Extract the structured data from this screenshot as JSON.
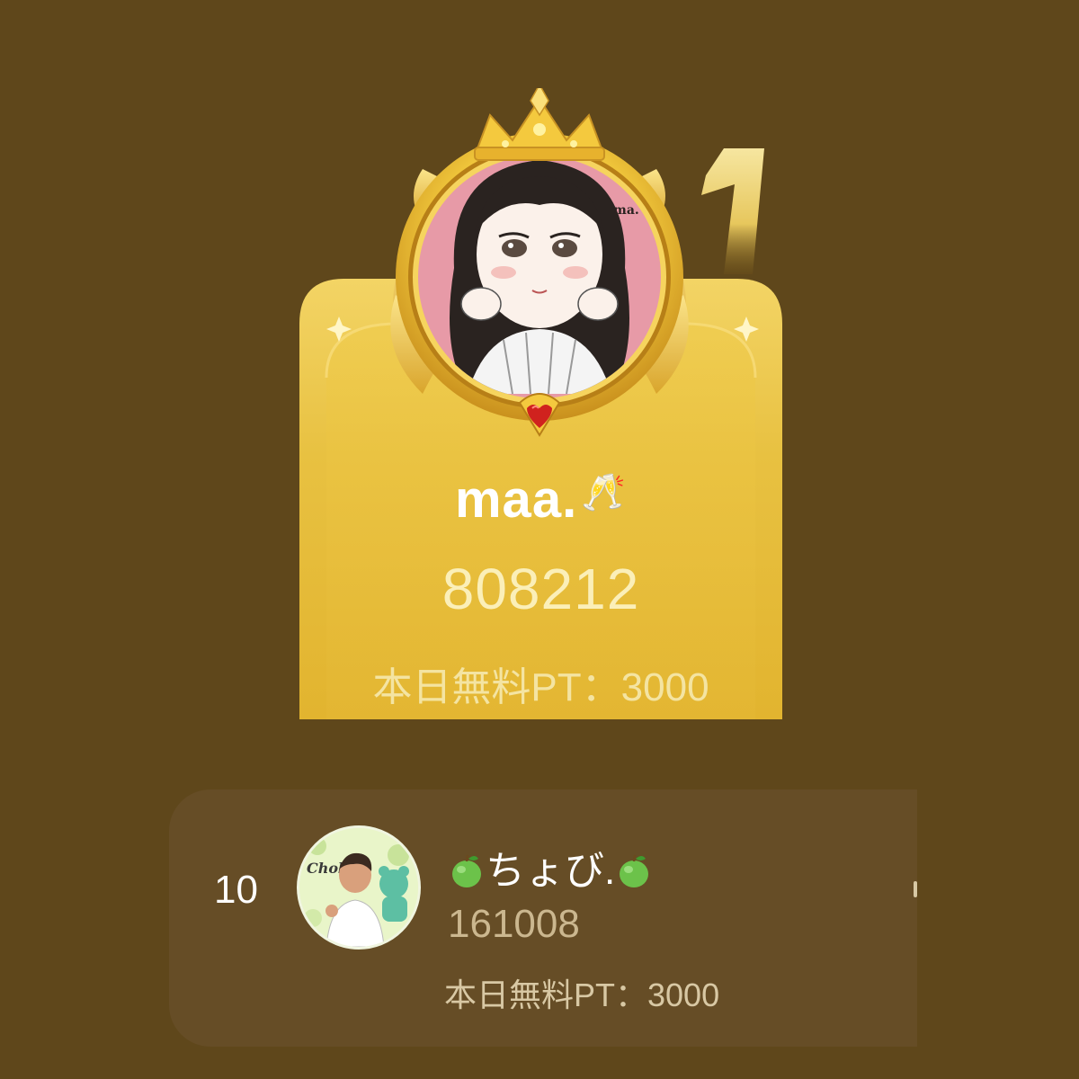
{
  "colors": {
    "background": "#5f471b",
    "gold_card": "#e7bd3a",
    "row_card": "#664d26",
    "avatar_bg": "#e79aa7"
  },
  "winner": {
    "rank": "1",
    "name": "maa.",
    "name_badge": "🥂",
    "score": "808212",
    "free_points": "本日無料PT：3000",
    "avatar_icon": "anime-girl-avatar",
    "frame_icon": "crown-laurel-frame"
  },
  "entries": [
    {
      "rank": "10",
      "name_prefix_icon": "green-apple-icon",
      "name": "ちょび.",
      "name_suffix_icon": "green-apple-icon",
      "score": "161008",
      "free_points": "本日無料PT：3000",
      "avatar_icon": "user-photo-avatar"
    }
  ]
}
